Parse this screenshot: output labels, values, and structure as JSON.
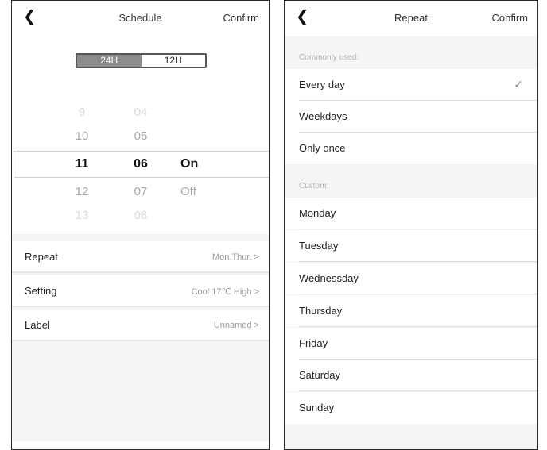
{
  "schedule_screen": {
    "back_icon": "chevron-left-icon",
    "title": "Schedule",
    "confirm_label": "Confirm",
    "format_toggle": {
      "option_24h": "24H",
      "option_12h": "12H",
      "selected": "24H"
    },
    "picker": {
      "hours": [
        "9",
        "10",
        "11",
        "12",
        "13"
      ],
      "minutes": [
        "04",
        "05",
        "06",
        "07",
        "08"
      ],
      "states": [
        "On",
        "Off"
      ],
      "selected": {
        "hour": "11",
        "minute": "06",
        "state": "On"
      }
    },
    "settings": [
      {
        "label": "Repeat",
        "value": "Mon.Thur. >"
      },
      {
        "label": "Setting",
        "value": "Cool 17℃ High >"
      },
      {
        "label": "Label",
        "value": "Unnamed >"
      }
    ]
  },
  "repeat_screen": {
    "back_icon": "chevron-left-icon",
    "title": "Repeat",
    "confirm_label": "Confirm",
    "commonly_used_label": "Commonly used:",
    "commonly_used": [
      "Every day",
      "Weekdays",
      "Only once"
    ],
    "selected": "Every day",
    "check_icon": "checkmark-icon",
    "custom_label": "Custom:",
    "custom": [
      "Monday",
      "Tuesday",
      "Wednessday",
      "Thursday",
      "Friday",
      "Saturday",
      "Sunday"
    ]
  }
}
